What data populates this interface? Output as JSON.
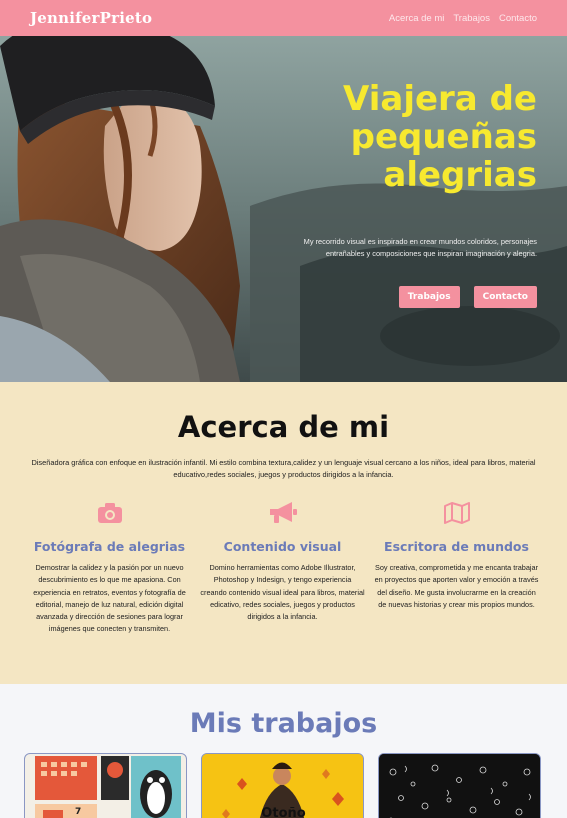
{
  "nav": {
    "brand": "JenniferPrieto",
    "links": [
      "Acerca de mi",
      "Trabajos",
      "Contacto"
    ]
  },
  "hero": {
    "title": "Viajera de pequeñas alegrias",
    "description": "My recorrido visual es inspirado en crear mundos coloridos, personajes entrañables y composiciones que inspiran imaginación y alegria.",
    "buttons": [
      "Trabajos",
      "Contacto"
    ]
  },
  "about": {
    "title": "Acerca de mi",
    "description": "Diseñadora gráfica con enfoque en ilustración infantil. Mi estilo combina textura,calidez y un lenguaje visual cercano a los niños, ideal para libros, material educativo,redes sociales, juegos y productos dirigidos a la infancia.",
    "features": [
      {
        "icon": "camera-icon",
        "title": "Fotógrafa de alegrias",
        "text": "Demostrar la calidez y la pasión por un nuevo descubrimiento es lo que me apasiona. Con experiencia en retratos, eventos y fotografía de editorial, manejo de luz natural, edición digital avanzada y dirección de sesiones para lograr imágenes que conecten y transmiten."
      },
      {
        "icon": "megaphone-icon",
        "title": "Contenido visual",
        "text": "Domino herramientas como Adobe Illustrator, Photoshop y Indesign, y tengo experiencia creando contenido visual ideal para libros, material edicativo, redes sociales, juegos y productos dirigidos a la infancia."
      },
      {
        "icon": "map-icon",
        "title": "Escritora de mundos",
        "text": "Soy creativa, comprometida y me encanta trabajar en proyectos que aporten valor y emoción a través del diseño. Me gusta involucrarme en la creación de nuevas historias y crear mis propios mundos."
      }
    ]
  },
  "works": {
    "title": "Mis trabajos",
    "cards": [
      {
        "calendar_day": "7"
      },
      {
        "caption": "Otoño"
      },
      {}
    ]
  },
  "colors": {
    "accent": "#f4919f",
    "highlight": "#f7e92f",
    "heading": "#6b7bb8",
    "about_bg": "#f4e6c3"
  }
}
